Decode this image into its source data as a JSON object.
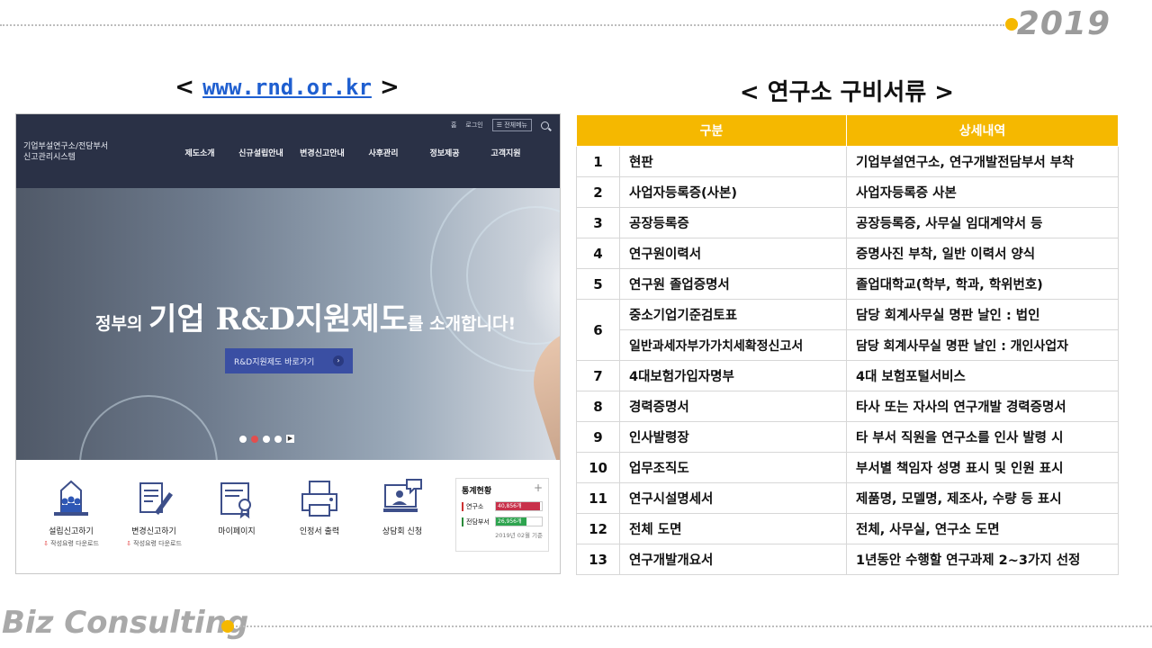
{
  "header": {
    "year": "2019"
  },
  "footer": {
    "brand": "Biz Consulting"
  },
  "left_section": {
    "title_left": "<",
    "url": "www.rnd.or.kr",
    "title_right": ">"
  },
  "right_section": {
    "title": "< 연구소 구비서류 >"
  },
  "site": {
    "util": {
      "home": "홈",
      "login": "로그인",
      "all_menu": "☰ 전체메뉴"
    },
    "logo": {
      "line1": "기업부설연구소/전담부서",
      "line2": "신고관리시스템"
    },
    "nav": [
      "제도소개",
      "신규설립안내",
      "변경신고안내",
      "사후관리",
      "정보제공",
      "고객지원"
    ],
    "hero": {
      "prefix": "정부의 ",
      "highlight": "기업 R&D지원제도",
      "suffix": "를 소개합니다!",
      "button": "R&D지원제도 바로가기",
      "button_arrow": "›",
      "pager_play": "▶"
    },
    "quick": [
      {
        "label": "설립신고하기",
        "sub_mark": "⇩",
        "sub": "작성요령 다운로드"
      },
      {
        "label": "변경신고하기",
        "sub_mark": "⇩",
        "sub": "작성요령 다운로드"
      },
      {
        "label": "마이페이지"
      },
      {
        "label": "인정서 출력"
      },
      {
        "label": "상담회 신청"
      }
    ],
    "stats": {
      "title": "통계현황",
      "plus": "+",
      "rows": [
        {
          "label": "연구소",
          "value": "40,856개",
          "fill_pct": 92
        },
        {
          "label": "전담부서",
          "value": "26,956개",
          "fill_pct": 62
        }
      ],
      "date": "2019년 02월 기준"
    }
  },
  "table": {
    "headers": [
      "구분",
      "상세내역"
    ],
    "rows": [
      {
        "no": "1",
        "item": "현판",
        "detail": "기업부설연구소, 연구개발전담부서 부착"
      },
      {
        "no": "2",
        "item": "사업자등록증(사본)",
        "detail": "사업자등록증 사본"
      },
      {
        "no": "3",
        "item": "공장등록증",
        "detail": "공장등록증, 사무실 임대계약서 등"
      },
      {
        "no": "4",
        "item": "연구원이력서",
        "detail": "증명사진 부착, 일반 이력서 양식"
      },
      {
        "no": "5",
        "item": "연구원 졸업증명서",
        "detail": "졸업대학교(학부, 학과, 학위번호)"
      },
      {
        "no": "6",
        "item": "중소기업기준검토표",
        "detail": "담당 회계사무실 명판 날인 : 법인"
      },
      {
        "no": "",
        "item": "일반과세자부가가치세확정신고서",
        "detail": "담당 회계사무실 명판 날인 : 개인사업자"
      },
      {
        "no": "7",
        "item": "4대보험가입자명부",
        "detail": "4대 보험포털서비스"
      },
      {
        "no": "8",
        "item": "경력증명서",
        "detail": "타사 또는 자사의 연구개발 경력증명서"
      },
      {
        "no": "9",
        "item": "인사발령장",
        "detail": "타 부서 직원을 연구소를 인사 발령 시"
      },
      {
        "no": "10",
        "item": "업무조직도",
        "detail": "부서별 책임자 성명 표시 및 인원 표시"
      },
      {
        "no": "11",
        "item": "연구시설명세서",
        "detail": "제품명, 모델명, 제조사, 수량 등 표시"
      },
      {
        "no": "12",
        "item": "전체 도면",
        "detail": "전체, 사무실, 연구소 도면"
      },
      {
        "no": "13",
        "item": "연구개발개요서",
        "detail": "1년동안 수행할 연구과제 2~3가지 선정"
      }
    ]
  }
}
